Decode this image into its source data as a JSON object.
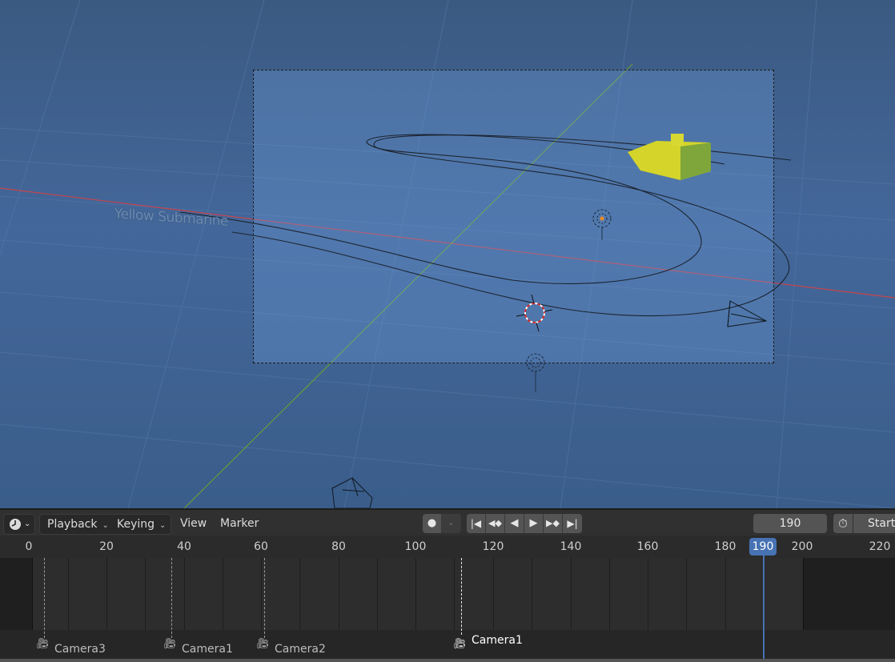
{
  "viewport": {
    "object_label": "Yellow Submarine"
  },
  "timeline_header": {
    "editor_type_icon": "clock-icon",
    "menus": [
      {
        "label": "Playback",
        "has_dropdown": true
      },
      {
        "label": "Keying",
        "has_dropdown": true
      },
      {
        "label": "View",
        "has_dropdown": false
      },
      {
        "label": "Marker",
        "has_dropdown": false
      }
    ],
    "record_icon": "record-dot-icon",
    "playback_buttons": [
      {
        "name": "jump-to-start-icon",
        "glyph": "⏮"
      },
      {
        "name": "jump-to-prev-keyframe-icon",
        "glyph": "◆"
      },
      {
        "name": "play-reverse-icon",
        "glyph": "◀"
      },
      {
        "name": "play-icon",
        "glyph": "▶"
      },
      {
        "name": "jump-to-next-keyframe-icon",
        "glyph": "◆"
      },
      {
        "name": "jump-to-end-icon",
        "glyph": "⏭"
      }
    ],
    "current_frame": "190",
    "start_label": "Start"
  },
  "ruler": {
    "ticks": [
      "0",
      "20",
      "40",
      "60",
      "80",
      "100",
      "120",
      "140",
      "160",
      "180",
      "200",
      "220"
    ],
    "current_frame": "190"
  },
  "markers": [
    {
      "label": "Camera3",
      "frame": 4,
      "selected": false
    },
    {
      "label": "Camera1",
      "frame": 37,
      "selected": false
    },
    {
      "label": "Camera2",
      "frame": 61,
      "selected": false
    },
    {
      "label": "Camera1",
      "frame": 112,
      "selected": true
    }
  ],
  "colors": {
    "accent": "#4772b3",
    "viewport_bg": "#3f6291",
    "submarine": "#d4d42a",
    "x_axis": "#c8444e",
    "y_axis": "#6a9a3a"
  }
}
